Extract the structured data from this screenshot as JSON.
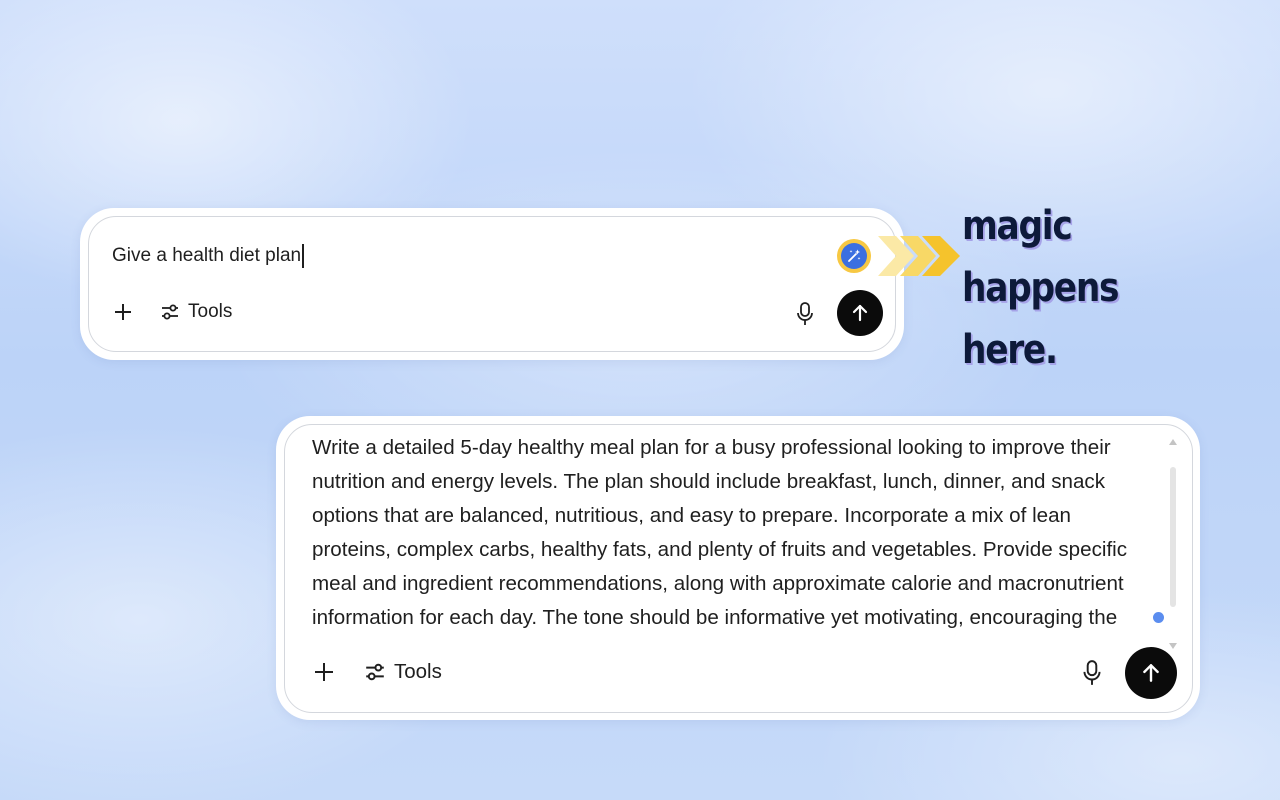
{
  "card1": {
    "prompt": "Give a health diet plan",
    "tools_label": "Tools",
    "icons": {
      "add": "plus-icon",
      "tools": "sliders-icon",
      "magic": "magic-wand-icon",
      "mic": "microphone-icon",
      "send": "arrow-up-icon"
    }
  },
  "tagline": {
    "line1": "magic",
    "line2": "happens here."
  },
  "card2": {
    "prompt": "Write a detailed 5-day healthy meal plan for a busy professional looking to improve their nutrition and energy levels. The plan should include breakfast, lunch, dinner, and snack options that are balanced, nutritious, and easy to prepare. Incorporate a mix of lean proteins, complex carbs, healthy fats, and plenty of fruits and vegetables. Provide specific meal and ingredient recommendations, along with approximate calorie and macronutrient information for each day. The tone should be informative yet motivating, encouraging the user to prioritize their health.",
    "tools_label": "Tools",
    "icons": {
      "add": "plus-icon",
      "tools": "sliders-icon",
      "mic": "microphone-icon",
      "send": "arrow-up-icon"
    }
  },
  "colors": {
    "accent_yellow": "#f7c843",
    "accent_blue": "#3b6fe0",
    "send_bg": "#0b0b0b",
    "tagline": "#0d1a3a"
  }
}
